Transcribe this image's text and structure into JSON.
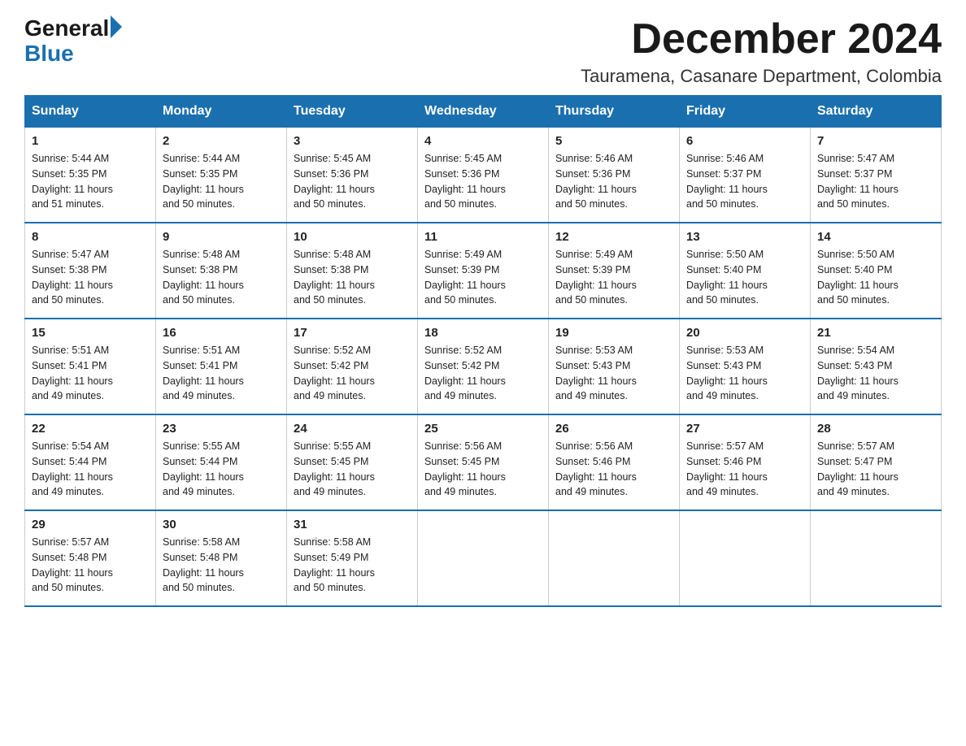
{
  "logo": {
    "general": "General",
    "blue": "Blue",
    "arrow": "▶"
  },
  "header": {
    "title": "December 2024",
    "subtitle": "Tauramena, Casanare Department, Colombia"
  },
  "days_of_week": [
    "Sunday",
    "Monday",
    "Tuesday",
    "Wednesday",
    "Thursday",
    "Friday",
    "Saturday"
  ],
  "weeks": [
    [
      {
        "day": "1",
        "sunrise": "5:44 AM",
        "sunset": "5:35 PM",
        "daylight": "11 hours and 51 minutes."
      },
      {
        "day": "2",
        "sunrise": "5:44 AM",
        "sunset": "5:35 PM",
        "daylight": "11 hours and 50 minutes."
      },
      {
        "day": "3",
        "sunrise": "5:45 AM",
        "sunset": "5:36 PM",
        "daylight": "11 hours and 50 minutes."
      },
      {
        "day": "4",
        "sunrise": "5:45 AM",
        "sunset": "5:36 PM",
        "daylight": "11 hours and 50 minutes."
      },
      {
        "day": "5",
        "sunrise": "5:46 AM",
        "sunset": "5:36 PM",
        "daylight": "11 hours and 50 minutes."
      },
      {
        "day": "6",
        "sunrise": "5:46 AM",
        "sunset": "5:37 PM",
        "daylight": "11 hours and 50 minutes."
      },
      {
        "day": "7",
        "sunrise": "5:47 AM",
        "sunset": "5:37 PM",
        "daylight": "11 hours and 50 minutes."
      }
    ],
    [
      {
        "day": "8",
        "sunrise": "5:47 AM",
        "sunset": "5:38 PM",
        "daylight": "11 hours and 50 minutes."
      },
      {
        "day": "9",
        "sunrise": "5:48 AM",
        "sunset": "5:38 PM",
        "daylight": "11 hours and 50 minutes."
      },
      {
        "day": "10",
        "sunrise": "5:48 AM",
        "sunset": "5:38 PM",
        "daylight": "11 hours and 50 minutes."
      },
      {
        "day": "11",
        "sunrise": "5:49 AM",
        "sunset": "5:39 PM",
        "daylight": "11 hours and 50 minutes."
      },
      {
        "day": "12",
        "sunrise": "5:49 AM",
        "sunset": "5:39 PM",
        "daylight": "11 hours and 50 minutes."
      },
      {
        "day": "13",
        "sunrise": "5:50 AM",
        "sunset": "5:40 PM",
        "daylight": "11 hours and 50 minutes."
      },
      {
        "day": "14",
        "sunrise": "5:50 AM",
        "sunset": "5:40 PM",
        "daylight": "11 hours and 50 minutes."
      }
    ],
    [
      {
        "day": "15",
        "sunrise": "5:51 AM",
        "sunset": "5:41 PM",
        "daylight": "11 hours and 49 minutes."
      },
      {
        "day": "16",
        "sunrise": "5:51 AM",
        "sunset": "5:41 PM",
        "daylight": "11 hours and 49 minutes."
      },
      {
        "day": "17",
        "sunrise": "5:52 AM",
        "sunset": "5:42 PM",
        "daylight": "11 hours and 49 minutes."
      },
      {
        "day": "18",
        "sunrise": "5:52 AM",
        "sunset": "5:42 PM",
        "daylight": "11 hours and 49 minutes."
      },
      {
        "day": "19",
        "sunrise": "5:53 AM",
        "sunset": "5:43 PM",
        "daylight": "11 hours and 49 minutes."
      },
      {
        "day": "20",
        "sunrise": "5:53 AM",
        "sunset": "5:43 PM",
        "daylight": "11 hours and 49 minutes."
      },
      {
        "day": "21",
        "sunrise": "5:54 AM",
        "sunset": "5:43 PM",
        "daylight": "11 hours and 49 minutes."
      }
    ],
    [
      {
        "day": "22",
        "sunrise": "5:54 AM",
        "sunset": "5:44 PM",
        "daylight": "11 hours and 49 minutes."
      },
      {
        "day": "23",
        "sunrise": "5:55 AM",
        "sunset": "5:44 PM",
        "daylight": "11 hours and 49 minutes."
      },
      {
        "day": "24",
        "sunrise": "5:55 AM",
        "sunset": "5:45 PM",
        "daylight": "11 hours and 49 minutes."
      },
      {
        "day": "25",
        "sunrise": "5:56 AM",
        "sunset": "5:45 PM",
        "daylight": "11 hours and 49 minutes."
      },
      {
        "day": "26",
        "sunrise": "5:56 AM",
        "sunset": "5:46 PM",
        "daylight": "11 hours and 49 minutes."
      },
      {
        "day": "27",
        "sunrise": "5:57 AM",
        "sunset": "5:46 PM",
        "daylight": "11 hours and 49 minutes."
      },
      {
        "day": "28",
        "sunrise": "5:57 AM",
        "sunset": "5:47 PM",
        "daylight": "11 hours and 49 minutes."
      }
    ],
    [
      {
        "day": "29",
        "sunrise": "5:57 AM",
        "sunset": "5:48 PM",
        "daylight": "11 hours and 50 minutes."
      },
      {
        "day": "30",
        "sunrise": "5:58 AM",
        "sunset": "5:48 PM",
        "daylight": "11 hours and 50 minutes."
      },
      {
        "day": "31",
        "sunrise": "5:58 AM",
        "sunset": "5:49 PM",
        "daylight": "11 hours and 50 minutes."
      },
      null,
      null,
      null,
      null
    ]
  ],
  "labels": {
    "sunrise": "Sunrise:",
    "sunset": "Sunset:",
    "daylight": "Daylight:"
  }
}
